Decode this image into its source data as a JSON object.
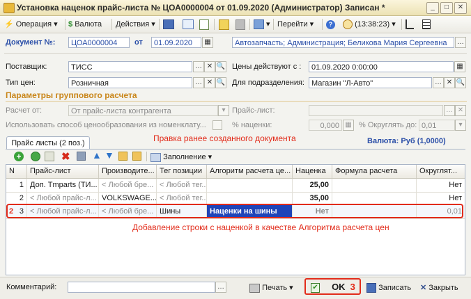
{
  "window": {
    "title": "Установка наценок прайс-листа № ЦОА0000004 от 01.09.2020 (Администратор) Записан *"
  },
  "toolbar": {
    "operation": "Операция",
    "currency": "Валюта",
    "actions": "Действия",
    "goto": "Перейти",
    "time": "(13:38:23)"
  },
  "doc": {
    "number_label": "Документ №:",
    "number": "ЦОА0000004",
    "from_label": "от",
    "date": "01.09.2020",
    "org": "Автозапчасть; Администрация; Беликова Мария Сергеевна"
  },
  "form": {
    "supplier_label": "Поставщик:",
    "supplier": "ТИСС",
    "prices_from_label": "Цены действуют с :",
    "prices_from": "01.09.2020  0:00:00",
    "price_type_label": "Тип цен:",
    "price_type": "Розничная",
    "department_label": "Для подразделения:",
    "department": "Магазин \"Л-Авто\"",
    "group_params_title": "Параметры группового расчета",
    "calc_from_label": "Расчет от:",
    "calc_from": "От прайс-листа контрагента",
    "pricelist_label": "Прайс-лист:",
    "use_method_label": "Использовать способ ценообразования из номенклату...",
    "markup_pct_label": "% наценки:",
    "markup_pct": "0,000",
    "round_label": "% Округлять до:",
    "round_value": "0,01"
  },
  "annotations": {
    "edit_note": "Правка ранее созданного документа",
    "add_row_note": "Добавление строки с наценкой в качестве Алгоритма расчета цен",
    "n2": "2",
    "n3": "3"
  },
  "tab": {
    "label": "Прайс листы (2 поз.)",
    "currency_info": "Валюта: Руб (1,0000)"
  },
  "grid_toolbar": {
    "fill": "Заполнение"
  },
  "grid": {
    "columns": [
      "N",
      "Прайс-лист",
      "Производите...",
      "Тег позиции",
      "Алгоритм расчета це...",
      "Наценка",
      "Формула расчета",
      "Округлят..."
    ],
    "rows": [
      {
        "n": "1",
        "pricelist": "Доп. Tmparts (ТИ...",
        "maker": "< Любой бре...",
        "tag": "< Любой тег...",
        "algo": "",
        "markup": "25,00",
        "formula": "",
        "round": "Нет"
      },
      {
        "n": "2",
        "pricelist": "< Любой прайс-л...",
        "maker": "VOLKSWAGE...",
        "tag": "< Любой тег...",
        "algo": "",
        "markup": "35,00",
        "formula": "",
        "round": "Нет"
      },
      {
        "n": "3",
        "pricelist": "< Любой прайс-л...",
        "maker": "< Любой бре...",
        "tag": "Шины",
        "algo": "Наценки на шины",
        "markup": "Нет",
        "formula": "",
        "round": "0,01"
      }
    ]
  },
  "bottom": {
    "comment_label": "Комментарий:",
    "print": "Печать",
    "ok": "OK",
    "save": "Записать",
    "close": "Закрыть"
  },
  "colors": {
    "accent_red": "#e22b1a",
    "label_blue": "#2b4fa8",
    "section_orange": "#c9861a",
    "selection_blue": "#1f44b8"
  }
}
